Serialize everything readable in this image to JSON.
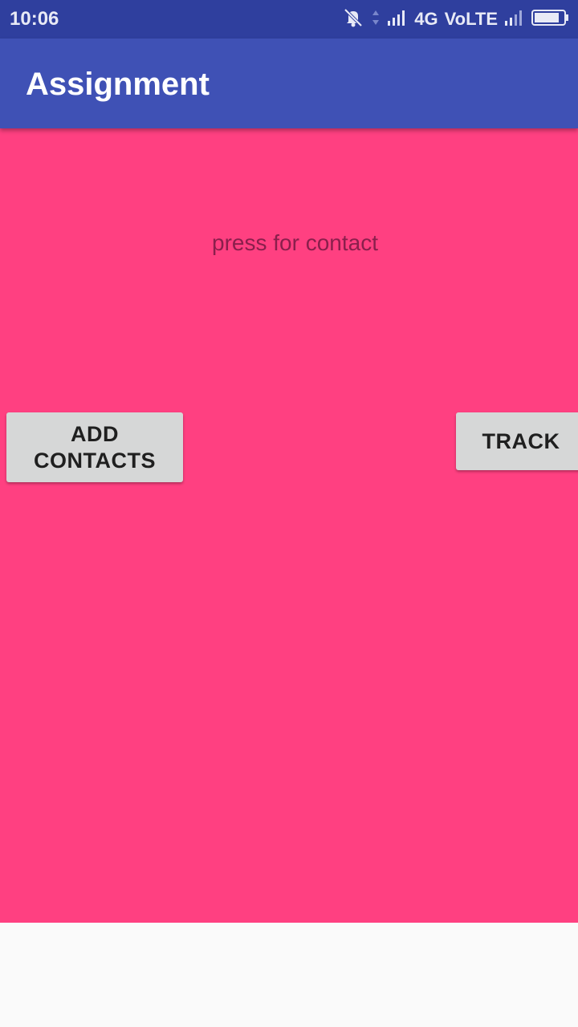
{
  "status_bar": {
    "time": "10:06",
    "network": "4G",
    "volte": "VoLTE",
    "icons": [
      "notifications-off-icon",
      "data-arrows-icon",
      "signal-icon",
      "signal-icon",
      "battery-icon"
    ]
  },
  "app_bar": {
    "title": "Assignment"
  },
  "main": {
    "prompt": "press for contact",
    "add_contacts_label": "ADD CONTACTS",
    "track_label": "TRACK"
  },
  "colors": {
    "status_bar": "#2f3f9e",
    "app_bar": "#3f51b5",
    "content_bg": "#ff4081",
    "button_bg": "#d6d7d7",
    "page_bg": "#fafafa"
  }
}
